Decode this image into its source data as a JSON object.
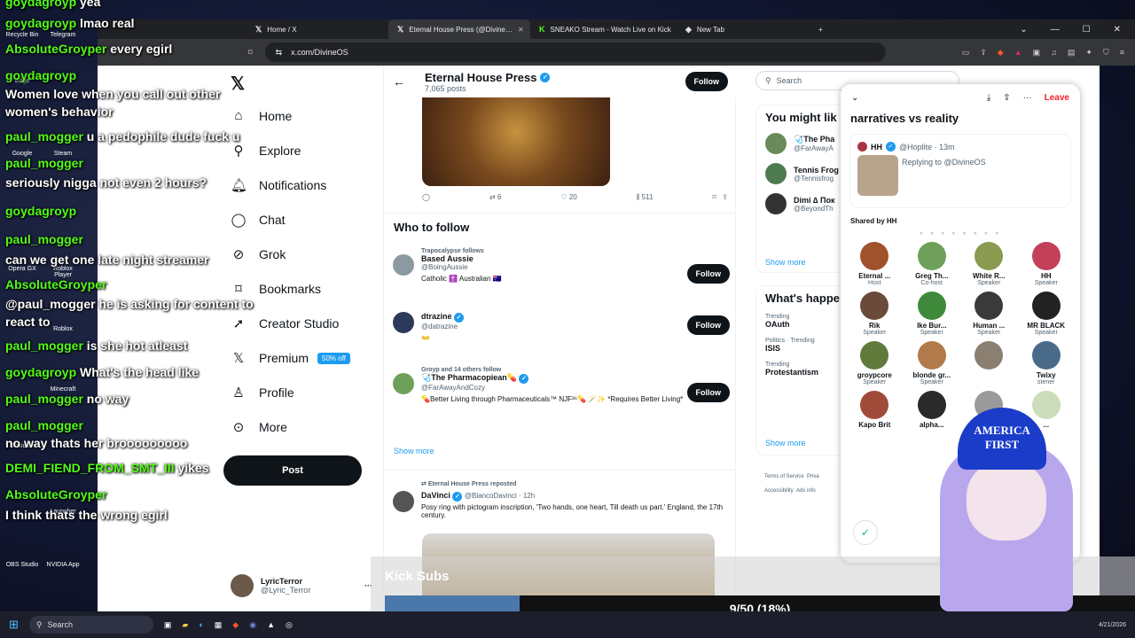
{
  "browser": {
    "tabs": [
      {
        "label": "Home / X",
        "icon": "x-icon"
      },
      {
        "label": "Eternal House Press (@Divine…",
        "icon": "x-icon"
      },
      {
        "label": "SNEAKO Stream - Watch Live on Kick",
        "icon": "kick-icon"
      },
      {
        "label": "New Tab",
        "icon": "brave-icon"
      }
    ],
    "url": "x.com/DivineOS"
  },
  "x": {
    "nav": {
      "home": "Home",
      "explore": "Explore",
      "notifications": "Notifications",
      "chat": "Chat",
      "grok": "Grok",
      "bookmarks": "Bookmarks",
      "creator_studio": "Creator Studio",
      "premium": "Premium",
      "premium_badge": "50% off",
      "profile": "Profile",
      "more": "More",
      "post": "Post"
    },
    "account": {
      "name": "LyricTerror",
      "handle": "@Lyric_Terror"
    },
    "profile": {
      "name": "Eternal House Press",
      "posts": "7,065 posts",
      "follow": "Follow"
    },
    "post_actions": {
      "retweets": "6",
      "likes": "20",
      "views": "511"
    },
    "who_to_follow": {
      "title": "Who to follow",
      "items": [
        {
          "context": "Trapocalypse follows",
          "name": "Based Aussie",
          "handle": "@BoingAussie",
          "bio": "Catholic ✝️ Australian 🇦🇺",
          "btn": "Follow"
        },
        {
          "context": "",
          "name": "dtrazine",
          "handle": "@datrazine",
          "bio": "👐",
          "btn": "Follow"
        },
        {
          "context": "Groyp and 14 others follow",
          "name": "🩺The Pharmacopiean💊",
          "handle": "@FarAwayAndCozy",
          "bio": "💊Better Living through Pharmaceuticals™ NJF³⁶💊 🪄✨ *Requires Better Living*",
          "btn": "Follow"
        }
      ],
      "show_more": "Show more"
    },
    "repost": {
      "context": "Eternal House Press reposted",
      "name": "DaVinci",
      "handle": "@BlancoDavinci · 12h",
      "text": "Posy ring with pictogram inscription, 'Two hands, one heart, Till death us part.' England, the 17th century."
    },
    "right": {
      "search_placeholder": "Search",
      "might_like": "You might lik",
      "suggestions": [
        {
          "name": "🩺The Pha",
          "handle": "@FarAwayA"
        },
        {
          "name": "Tennis Frog",
          "handle": "@Tennisfrog"
        },
        {
          "name": "Dimi ∆ Пок",
          "handle": "@BeyondTh"
        }
      ],
      "show_more_1": "Show more",
      "happening": "What's happe",
      "trends": [
        {
          "category": "Trending",
          "topic": "OAuth"
        },
        {
          "category": "Politics · Trending",
          "topic": "ISIS"
        },
        {
          "category": "Trending",
          "topic": "Protestantism"
        }
      ],
      "show_more_2": "Show more",
      "footer": [
        "Terms of Service",
        "Priva",
        "Accessibility",
        "Ads info"
      ]
    }
  },
  "space": {
    "leave": "Leave",
    "title": "narratives vs reality",
    "pinned": {
      "name": "HH",
      "handle": "@Hoplite · 13m",
      "reply": "Replying to @DivineOS"
    },
    "shared_by": "Shared by HH",
    "speakers": [
      {
        "name": "Eternal ...",
        "role": "Host"
      },
      {
        "name": "Greg Th...",
        "role": "Co-host"
      },
      {
        "name": "White R...",
        "role": "Speaker"
      },
      {
        "name": "HH",
        "role": "Speaker"
      },
      {
        "name": "Rik",
        "role": "Speaker"
      },
      {
        "name": "Ike Bur...",
        "role": "Speaker"
      },
      {
        "name": "Human ...",
        "role": "Speaker"
      },
      {
        "name": "MR BLACK",
        "role": "Speaker"
      },
      {
        "name": "groypcore",
        "role": "Speaker"
      },
      {
        "name": "blonde gr...",
        "role": "Speaker"
      },
      {
        "name": "",
        "role": ""
      },
      {
        "name": "Twixy",
        "role": "stener"
      },
      {
        "name": "Kapo Brit",
        "role": ""
      },
      {
        "name": "alpha...",
        "role": ""
      },
      {
        "name": "",
        "role": ""
      },
      {
        "name": "...",
        "role": ""
      }
    ]
  },
  "chat": [
    {
      "user": "goydagroyp",
      "msg": "yea"
    },
    {
      "user": "goydagroyp",
      "msg": "lmao real"
    },
    {
      "user": "AbsoluteGroyper",
      "msg": "every egirl"
    },
    {
      "user": "goydagroyp",
      "msg": ""
    },
    {
      "user": "",
      "msg": "Women love when you call out other"
    },
    {
      "user": "",
      "msg": "women's behavior"
    },
    {
      "user": "paul_mogger",
      "msg": "u a pedophile dude fuck u"
    },
    {
      "user": "paul_mogger",
      "msg": ""
    },
    {
      "user": "",
      "msg": "seriously nigga not even 2 hours?"
    },
    {
      "user": "goydagroyp",
      "msg": ""
    },
    {
      "user": "paul_mogger",
      "msg": ""
    },
    {
      "user": "",
      "msg": "can we get one late night streamer"
    },
    {
      "user": "AbsoluteGroyper",
      "msg": ""
    },
    {
      "user": "",
      "msg": "@paul_mogger he is asking for content to"
    },
    {
      "user": "",
      "msg": "react to"
    },
    {
      "user": "paul_mogger",
      "msg": "is she hot atleast"
    },
    {
      "user": "goydagroyp",
      "msg": "What's the head like"
    },
    {
      "user": "paul_mogger",
      "msg": "no way"
    },
    {
      "user": "paul_mogger",
      "msg": ""
    },
    {
      "user": "",
      "msg": "no way thats her brooooooooo"
    },
    {
      "user": "DEMI_FIEND_FROM_SMT_III",
      "msg": "yikes"
    },
    {
      "user": "AbsoluteGroyper",
      "msg": ""
    },
    {
      "user": "",
      "msg": "I think thats the wrong egirl"
    }
  ],
  "desktop_icons": [
    "Recycle Bin",
    "Telegram",
    "Edge",
    "Google",
    "Steam",
    "Opera GX",
    "Roblox Player",
    "Roblox",
    "Minecraft",
    "Obsidian",
    "Launcher",
    "OBS Studio",
    "NVIDIA App"
  ],
  "kick": {
    "label": "Kick Subs",
    "progress_text": "9/50 (18%)",
    "progress": 0.18
  },
  "vtuber": {
    "hat_text": "AMERICA FIRST"
  },
  "taskbar": {
    "search": "Search",
    "date": "4/21/2026"
  }
}
